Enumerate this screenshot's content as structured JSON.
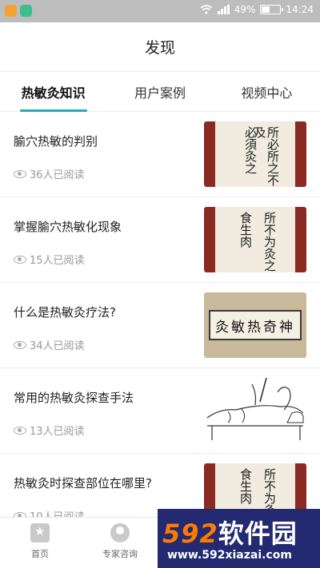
{
  "status_bar": {
    "battery": "49%",
    "time": "14:24",
    "battery_level": 0.49,
    "icons": [
      "app-notification-icon",
      "app-notification-icon",
      "wifi-icon",
      "signal-icon",
      "battery-icon"
    ],
    "colors": {
      "background": "#bdbdbd",
      "app_icon_1": "#f2a234",
      "app_icon_2": "#3cbf8c"
    }
  },
  "header": {
    "title": "发现"
  },
  "tabs": [
    {
      "label": "热敏灸知识",
      "active": true
    },
    {
      "label": "用户案例",
      "active": false
    },
    {
      "label": "视频中心",
      "active": false
    }
  ],
  "accent_color": "#2aa8b8",
  "articles": [
    {
      "title": "腧穴热敏的判别",
      "reads": "36人已阅读",
      "thumb": "calligraphy-scroll-image",
      "chars": [
        "所必所之不及",
        "必須灸之"
      ]
    },
    {
      "title": "掌握腧穴热敏化现象",
      "reads": "15人已阅读",
      "thumb": "calligraphy-scroll-image",
      "chars": [
        "食生肉",
        "所不为灸之"
      ]
    },
    {
      "title": "什么是热敏灸疗法?",
      "reads": "34人已阅读",
      "thumb": "calligraphy-plaque-image",
      "plaque_text": "神奇热敏灸"
    },
    {
      "title": "常用的热敏灸探查手法",
      "reads": "13人已阅读",
      "thumb": "moxibustion-sketch-image"
    },
    {
      "title": "热敏灸时探查部位在哪里?",
      "reads": "10人已阅读",
      "thumb": "calligraphy-scroll-image",
      "chars": [
        "食生肉",
        "所不为灸之"
      ]
    }
  ],
  "bottom_nav": [
    {
      "label": "首页",
      "icon": "home-icon"
    },
    {
      "label": "专家咨询",
      "icon": "expert-icon"
    }
  ],
  "watermark": {
    "logo_num": "592",
    "logo_text": "软件园",
    "url": "www.592xiazai.com"
  }
}
